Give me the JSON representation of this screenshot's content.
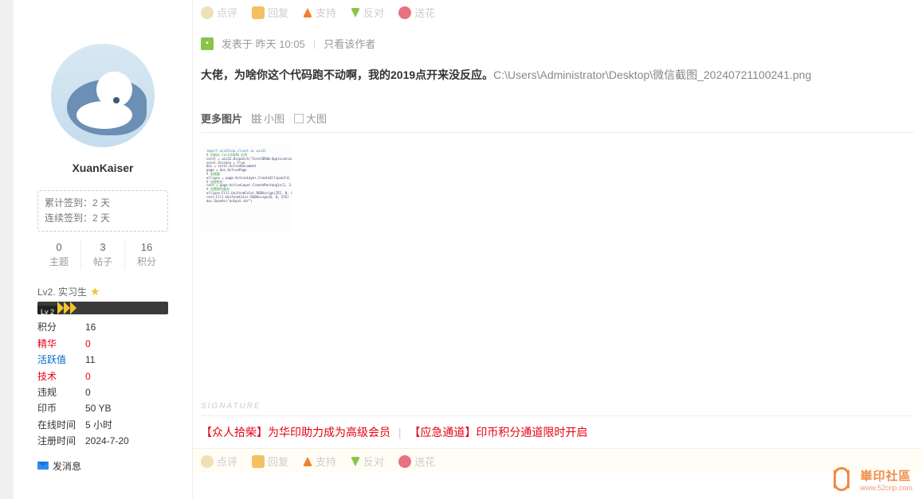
{
  "sidebar": {
    "username": "XuanKaiser",
    "checkin": {
      "cumulative_label": "累计签到：2 天",
      "consecutive_label": "连续签到：2 天"
    },
    "stats": [
      {
        "num": "0",
        "label": "主题"
      },
      {
        "num": "3",
        "label": "帖子"
      },
      {
        "num": "16",
        "label": "积分"
      }
    ],
    "level_text": "Lv2. 实习生",
    "level_badge": "Lv 2",
    "info_rows": [
      {
        "label": "积分",
        "value": "16",
        "color": ""
      },
      {
        "label": "精华",
        "value": "0",
        "color": "red"
      },
      {
        "label": "活跃值",
        "value": "11",
        "color": "blue"
      },
      {
        "label": "技术",
        "value": "0",
        "color": "red"
      },
      {
        "label": "违规",
        "value": "0",
        "color": ""
      },
      {
        "label": "印币",
        "value": "50 YB",
        "color": ""
      },
      {
        "label": "在线时间",
        "value": "5 小时",
        "color": ""
      },
      {
        "label": "注册时间",
        "value": "2024-7-20",
        "color": ""
      }
    ],
    "send_message": "发消息"
  },
  "actions": [
    {
      "label": "点评",
      "color": "#e8c878"
    },
    {
      "label": "回复",
      "color": "#f4b040"
    },
    {
      "label": "支持",
      "color": "#f08030"
    },
    {
      "label": "反对",
      "color": "#8bc34a"
    },
    {
      "label": "送花",
      "color": "#e87080"
    }
  ],
  "post": {
    "posted_label": "发表于",
    "posted_time": "昨天 10:05",
    "only_author": "只看该作者",
    "content_bold": "大佬，为啥你这个代码跑不动啊，我的2019点开来没反应。",
    "content_gray": "C:\\Users\\Administrator\\Desktop\\微信截图_20240721100241.png"
  },
  "images": {
    "more_label": "更多图片",
    "small_view": "小图",
    "large_view": "大图"
  },
  "signature": {
    "label": "SIGNATURE",
    "link1": "【众人拾柴】为华印助力成为高级会员",
    "divider": "|",
    "link2": "【应急通道】印币积分通道限时开启"
  },
  "watermark": {
    "cn": "崋印社區",
    "url": "www.52cnp.com"
  }
}
